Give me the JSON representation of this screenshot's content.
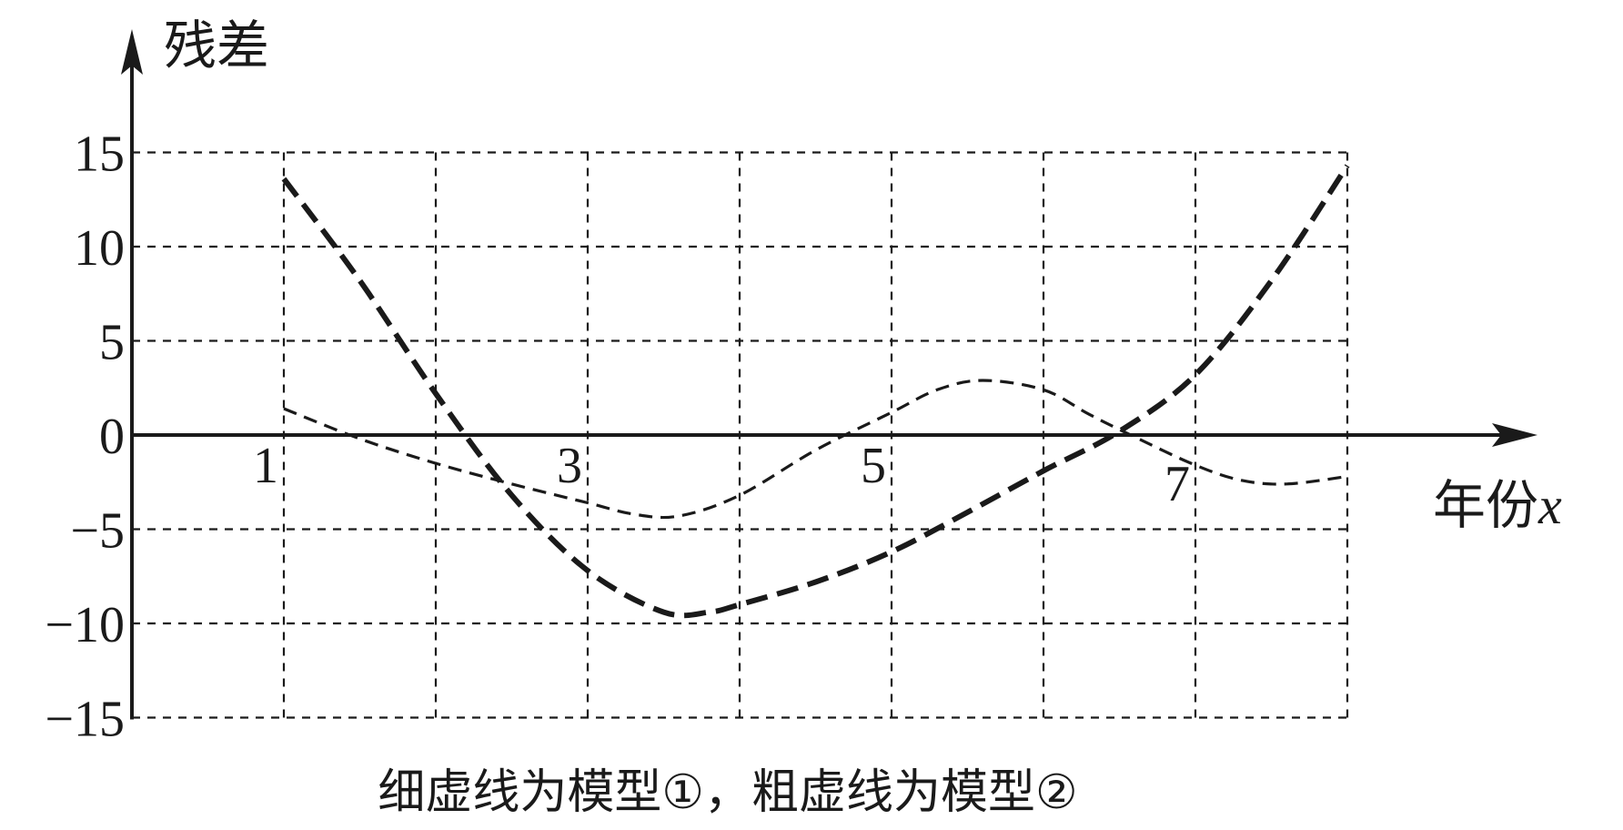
{
  "chart_data": {
    "type": "line",
    "ylabel": "残差",
    "xlabel": "年份",
    "xvar": "x",
    "caption": "细虚线为模型①，粗虚线为模型②",
    "xlim": [
      0,
      9.5
    ],
    "ylim": [
      -15,
      15
    ],
    "x_ticks": [
      1,
      3,
      5,
      7
    ],
    "x_tick_labels": [
      "1",
      "3",
      "5",
      "7"
    ],
    "y_ticks": [
      15,
      10,
      5,
      0,
      -5,
      -10,
      -15
    ],
    "y_tick_labels": [
      "15",
      "10",
      "5",
      "0",
      "−5",
      "−10",
      "−15"
    ],
    "grid_x": [
      1,
      2,
      3,
      4,
      5,
      6,
      7,
      8
    ],
    "grid_y": [
      15,
      10,
      5,
      -5,
      -10,
      -15
    ],
    "grid": true,
    "series": [
      {
        "style": "thin-dashed",
        "x": [
          1,
          1.5,
          2,
          2.5,
          3,
          3.3,
          3.6,
          4,
          4.5,
          5,
          5.3,
          5.6,
          6,
          6.3,
          6.6,
          7,
          7.3,
          7.6,
          8
        ],
        "y": [
          1.4,
          -0.2,
          -1.5,
          -2.6,
          -3.6,
          -4.2,
          -4.3,
          -3.2,
          -0.8,
          1.2,
          2.4,
          2.9,
          2.4,
          1.1,
          -0.1,
          -1.6,
          -2.4,
          -2.6,
          -2.2
        ]
      },
      {
        "style": "thick-dashed",
        "x": [
          1,
          1.5,
          2,
          2.5,
          3,
          3.5,
          3.8,
          4,
          4.5,
          5,
          5.5,
          6,
          6.5,
          7,
          7.5,
          8
        ],
        "y": [
          13.6,
          8.2,
          2.2,
          -3.2,
          -7.2,
          -9.4,
          -9.4,
          -9.0,
          -7.8,
          -6.2,
          -4.1,
          -1.9,
          0.2,
          3.2,
          8.2,
          14.3
        ]
      }
    ]
  }
}
